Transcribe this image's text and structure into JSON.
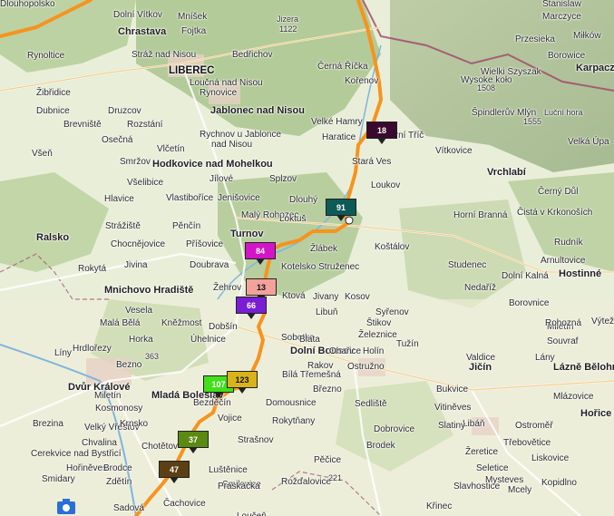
{
  "map": {
    "route_color": "#f7931e",
    "labels": [
      {
        "text": "Dolní Vítkov",
        "cls": ""
      },
      {
        "text": "Chrastava",
        "cls": "big"
      },
      {
        "text": "Mníšek",
        "cls": ""
      },
      {
        "text": "Fojtka",
        "cls": ""
      },
      {
        "text": "Jizera",
        "cls": "peak"
      },
      {
        "text": "1122",
        "cls": "peak"
      },
      {
        "text": "Stanislaw",
        "cls": ""
      },
      {
        "text": "Marczyce",
        "cls": ""
      },
      {
        "text": "Rynoltice",
        "cls": ""
      },
      {
        "text": "Stráž nad Nisou",
        "cls": ""
      },
      {
        "text": "Bedřichov",
        "cls": ""
      },
      {
        "text": "Przesieka",
        "cls": ""
      },
      {
        "text": "Miłków",
        "cls": ""
      },
      {
        "text": "LIBEREC",
        "cls": "city"
      },
      {
        "text": "Černá Říčka",
        "cls": ""
      },
      {
        "text": "Borowice",
        "cls": ""
      },
      {
        "text": "Wielki Szyszak",
        "cls": ""
      },
      {
        "text": "Wysoke koło",
        "cls": ""
      },
      {
        "text": "1508",
        "cls": "peak"
      },
      {
        "text": "Karpacz",
        "cls": "big"
      },
      {
        "text": "Loučná nad Nisou",
        "cls": ""
      },
      {
        "text": "Kořenov",
        "cls": ""
      },
      {
        "text": "Žibřidice",
        "cls": ""
      },
      {
        "text": "Rynovice",
        "cls": ""
      },
      {
        "text": "Jablonec nad Nisou",
        "cls": "big"
      },
      {
        "text": "Dubnice",
        "cls": ""
      },
      {
        "text": "Druzcov",
        "cls": ""
      },
      {
        "text": "Luční hora",
        "cls": "peak"
      },
      {
        "text": "Špindlerův Mlýn",
        "cls": ""
      },
      {
        "text": "1555",
        "cls": "peak"
      },
      {
        "text": "Brevniště",
        "cls": ""
      },
      {
        "text": "Rozstání",
        "cls": ""
      },
      {
        "text": "Velké Hamry",
        "cls": ""
      },
      {
        "text": "Rychnov u Jablonce",
        "cls": ""
      },
      {
        "text": "nad Nisou",
        "cls": ""
      },
      {
        "text": "Haratice",
        "cls": ""
      },
      {
        "text": "Horní Tříč",
        "cls": ""
      },
      {
        "text": "Velká Úpa",
        "cls": ""
      },
      {
        "text": "Osečná",
        "cls": ""
      },
      {
        "text": "Vítkovice",
        "cls": ""
      },
      {
        "text": "Všeň",
        "cls": ""
      },
      {
        "text": "Vlčetín",
        "cls": ""
      },
      {
        "text": "Smržov",
        "cls": ""
      },
      {
        "text": "Hodkovice nad Mohelkou",
        "cls": "big"
      },
      {
        "text": "Stará Ves",
        "cls": ""
      },
      {
        "text": "Všelibice",
        "cls": ""
      },
      {
        "text": "Jílové",
        "cls": ""
      },
      {
        "text": "Splzov",
        "cls": ""
      },
      {
        "text": "Vrchlabí",
        "cls": "big"
      },
      {
        "text": "Hlavice",
        "cls": ""
      },
      {
        "text": "Vlastiboříce",
        "cls": ""
      },
      {
        "text": "Jenišovice",
        "cls": ""
      },
      {
        "text": "Dlouhý",
        "cls": ""
      },
      {
        "text": "Loukov",
        "cls": ""
      },
      {
        "text": "Černý Důl",
        "cls": ""
      },
      {
        "text": "Ralsko",
        "cls": "big"
      },
      {
        "text": "Strážiště",
        "cls": ""
      },
      {
        "text": "Pěnčín",
        "cls": ""
      },
      {
        "text": "Malý Rohozec",
        "cls": ""
      },
      {
        "text": "Horní Branná",
        "cls": ""
      },
      {
        "text": "Čistá v Krkonoších",
        "cls": ""
      },
      {
        "text": "Chocnějovice",
        "cls": ""
      },
      {
        "text": "Příšovice",
        "cls": ""
      },
      {
        "text": "Turnov",
        "cls": "big"
      },
      {
        "text": "Loktuš",
        "cls": ""
      },
      {
        "text": "Žlábek",
        "cls": ""
      },
      {
        "text": "Rudník",
        "cls": ""
      },
      {
        "text": "Koštálov",
        "cls": ""
      },
      {
        "text": "Rokytá",
        "cls": ""
      },
      {
        "text": "Jivina",
        "cls": ""
      },
      {
        "text": "Doubrava",
        "cls": ""
      },
      {
        "text": "Kotelsko Struženec",
        "cls": ""
      },
      {
        "text": "Studenec",
        "cls": ""
      },
      {
        "text": "Arnultovice",
        "cls": ""
      },
      {
        "text": "Mnichovo Hradiště",
        "cls": "big"
      },
      {
        "text": "Žehrov",
        "cls": ""
      },
      {
        "text": "Nedaříž",
        "cls": ""
      },
      {
        "text": "Dolní Kalná",
        "cls": ""
      },
      {
        "text": "Hostinné",
        "cls": "big"
      },
      {
        "text": "Ktová",
        "cls": ""
      },
      {
        "text": "Jivany",
        "cls": ""
      },
      {
        "text": "Kosov",
        "cls": ""
      },
      {
        "text": "Vesela",
        "cls": ""
      },
      {
        "text": "Libuň",
        "cls": ""
      },
      {
        "text": "Syřenov",
        "cls": ""
      },
      {
        "text": "Borovnice",
        "cls": ""
      },
      {
        "text": "Malá Bělá",
        "cls": ""
      },
      {
        "text": "Kněžmost",
        "cls": ""
      },
      {
        "text": "Dobšín",
        "cls": ""
      },
      {
        "text": "Železnice",
        "cls": ""
      },
      {
        "text": "Štikov",
        "cls": ""
      },
      {
        "text": "Miletín",
        "cls": ""
      },
      {
        "text": "Rohozná",
        "cls": ""
      },
      {
        "text": "Výtež",
        "cls": ""
      },
      {
        "text": "Horka",
        "cls": ""
      },
      {
        "text": "Sobotka",
        "cls": ""
      },
      {
        "text": "Blata",
        "cls": ""
      },
      {
        "text": "Tužín",
        "cls": ""
      },
      {
        "text": "Souvraf",
        "cls": ""
      },
      {
        "text": "Líny",
        "cls": ""
      },
      {
        "text": "Hrdlořezy",
        "cls": ""
      },
      {
        "text": "Bezno",
        "cls": ""
      },
      {
        "text": "363",
        "cls": "peak"
      },
      {
        "text": "Úhelnice",
        "cls": ""
      },
      {
        "text": "Dolní Bousov",
        "cls": "big"
      },
      {
        "text": "Ohařice",
        "cls": ""
      },
      {
        "text": "Holín",
        "cls": ""
      },
      {
        "text": "Valdice",
        "cls": ""
      },
      {
        "text": "Lány",
        "cls": ""
      },
      {
        "text": "Bílá Třemešná",
        "cls": ""
      },
      {
        "text": "Rakov",
        "cls": ""
      },
      {
        "text": "Ostružno",
        "cls": ""
      },
      {
        "text": "Jičín",
        "cls": "big"
      },
      {
        "text": "Lázně Bělohrad",
        "cls": "big"
      },
      {
        "text": "Dvůr Králové",
        "cls": "big"
      },
      {
        "text": "Mladá Boleslav",
        "cls": "big"
      },
      {
        "text": "Březno",
        "cls": ""
      },
      {
        "text": "Bukvice",
        "cls": ""
      },
      {
        "text": "Mlázovice",
        "cls": ""
      },
      {
        "text": "Miletín",
        "cls": ""
      },
      {
        "text": "Kosmonosy",
        "cls": ""
      },
      {
        "text": "Bezděčín",
        "cls": ""
      },
      {
        "text": "Domousnice",
        "cls": ""
      },
      {
        "text": "Sedliště",
        "cls": ""
      },
      {
        "text": "Vitiněves",
        "cls": ""
      },
      {
        "text": "Vojice",
        "cls": ""
      },
      {
        "text": "Rokytňany",
        "cls": ""
      },
      {
        "text": "Libáň",
        "cls": ""
      },
      {
        "text": "Ostroměř",
        "cls": ""
      },
      {
        "text": "Hořice",
        "cls": "big"
      },
      {
        "text": "Velký Vřeštov",
        "cls": ""
      },
      {
        "text": "Brezina",
        "cls": ""
      },
      {
        "text": "Krnsko",
        "cls": ""
      },
      {
        "text": "Dobrovice",
        "cls": ""
      },
      {
        "text": "Slatiny",
        "cls": ""
      },
      {
        "text": "Třebovětice",
        "cls": ""
      },
      {
        "text": "Chvalina",
        "cls": ""
      },
      {
        "text": "Strašnov",
        "cls": ""
      },
      {
        "text": "Brodek",
        "cls": ""
      },
      {
        "text": "Žeretice",
        "cls": ""
      },
      {
        "text": "Liskovice",
        "cls": ""
      },
      {
        "text": "Cerekvice nad Bystřicí",
        "cls": ""
      },
      {
        "text": "Chotětov",
        "cls": ""
      },
      {
        "text": "Pěčice",
        "cls": ""
      },
      {
        "text": "Kopidlno",
        "cls": ""
      },
      {
        "text": "Hořiněves",
        "cls": ""
      },
      {
        "text": "Brodce",
        "cls": ""
      },
      {
        "text": "Luštěnice",
        "cls": ""
      },
      {
        "text": "Seletice",
        "cls": ""
      },
      {
        "text": "Smidary",
        "cls": ""
      },
      {
        "text": "Zdětín",
        "cls": ""
      },
      {
        "text": "Smilovice",
        "cls": ""
      },
      {
        "text": "Rožďalovice",
        "cls": ""
      },
      {
        "text": "221",
        "cls": "peak"
      },
      {
        "text": "Slavhostice",
        "cls": ""
      },
      {
        "text": "Mysteves",
        "cls": ""
      },
      {
        "text": "Praskačka",
        "cls": ""
      },
      {
        "text": "Mcely",
        "cls": ""
      },
      {
        "text": "Sadová",
        "cls": ""
      },
      {
        "text": "Čachovice",
        "cls": ""
      },
      {
        "text": "Loučeň",
        "cls": ""
      },
      {
        "text": "Křinec",
        "cls": ""
      },
      {
        "text": "Dlouhopolsko",
        "cls": ""
      }
    ],
    "markers": [
      {
        "label": "18",
        "color": "#3a0a2e",
        "text": "dark"
      },
      {
        "label": "91",
        "color": "#0e5a56",
        "text": "dark"
      },
      {
        "label": "84",
        "color": "#d414c8",
        "text": "dark"
      },
      {
        "label": "13",
        "color": "#f2a29a",
        "text": "light"
      },
      {
        "label": "66",
        "color": "#7a1ed6",
        "text": "dark"
      },
      {
        "label": "107",
        "color": "#41e01a",
        "text": "dark"
      },
      {
        "label": "123",
        "color": "#d8b41a",
        "text": "light"
      },
      {
        "label": "37",
        "color": "#5a8a12",
        "text": "dark"
      },
      {
        "label": "47",
        "color": "#5a4012",
        "text": "dark"
      }
    ]
  }
}
